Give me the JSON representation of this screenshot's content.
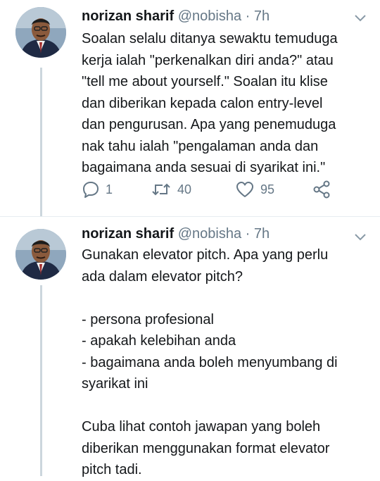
{
  "tweets": [
    {
      "name": "norizan sharif",
      "handle": "@nobisha",
      "dot": "·",
      "time": "7h",
      "text": "Soalan selalu ditanya sewaktu temuduga\nkerja ialah \"perkenalkan diri anda?\" atau\n\"tell me about yourself.\" Soalan itu klise\ndan diberikan kepada calon entry-level\ndan pengurusan. Apa yang penemuduga\nnak tahu ialah \"pengalaman anda dan\nbagaimana anda sesuai di syarikat ini.\"",
      "replies": "1",
      "retweets": "40",
      "likes": "95"
    },
    {
      "name": "norizan sharif",
      "handle": "@nobisha",
      "dot": "·",
      "time": "7h",
      "text": "Gunakan elevator pitch. Apa yang perlu\nada dalam elevator pitch?\n\n- persona profesional\n- apakah kelebihan anda\n- bagaimana anda boleh menyumbang di\nsyarikat ini\n\nCuba lihat contoh jawapan yang boleh\ndiberikan menggunakan format elevator\npitch tadi."
    }
  ],
  "colors": {
    "text": "#14171a",
    "secondary": "#657786",
    "thread_line": "#ccd6dd",
    "divider": "#e6ecf0"
  },
  "icons": [
    "chevron-down-icon",
    "reply-icon",
    "retweet-icon",
    "like-icon",
    "share-icon"
  ]
}
